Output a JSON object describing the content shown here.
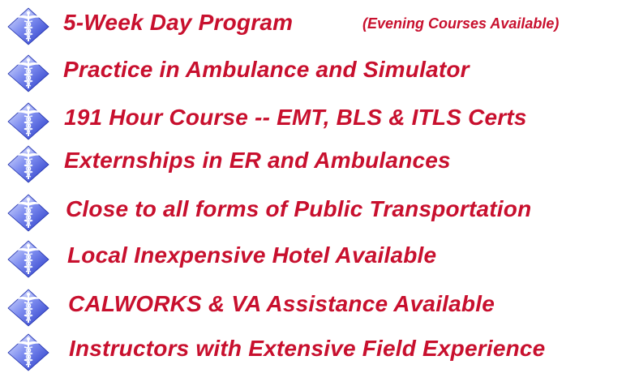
{
  "accent_color": "#c8102e",
  "icon_name": "caduceus-diamond-icon",
  "items": [
    {
      "label": "5-Week Day Program",
      "note": "(Evening Courses Available)"
    },
    {
      "label": "Practice in Ambulance and Simulator"
    },
    {
      "label": "191 Hour Course -- EMT, BLS & ITLS Certs"
    },
    {
      "label": "Externships in ER and Ambulances"
    },
    {
      "label": "Close to all forms of Public Transportation"
    },
    {
      "label": "Local Inexpensive Hotel Available"
    },
    {
      "label": "CALWORKS & VA Assistance Available"
    },
    {
      "label": "Instructors with Extensive Field Experience"
    }
  ]
}
